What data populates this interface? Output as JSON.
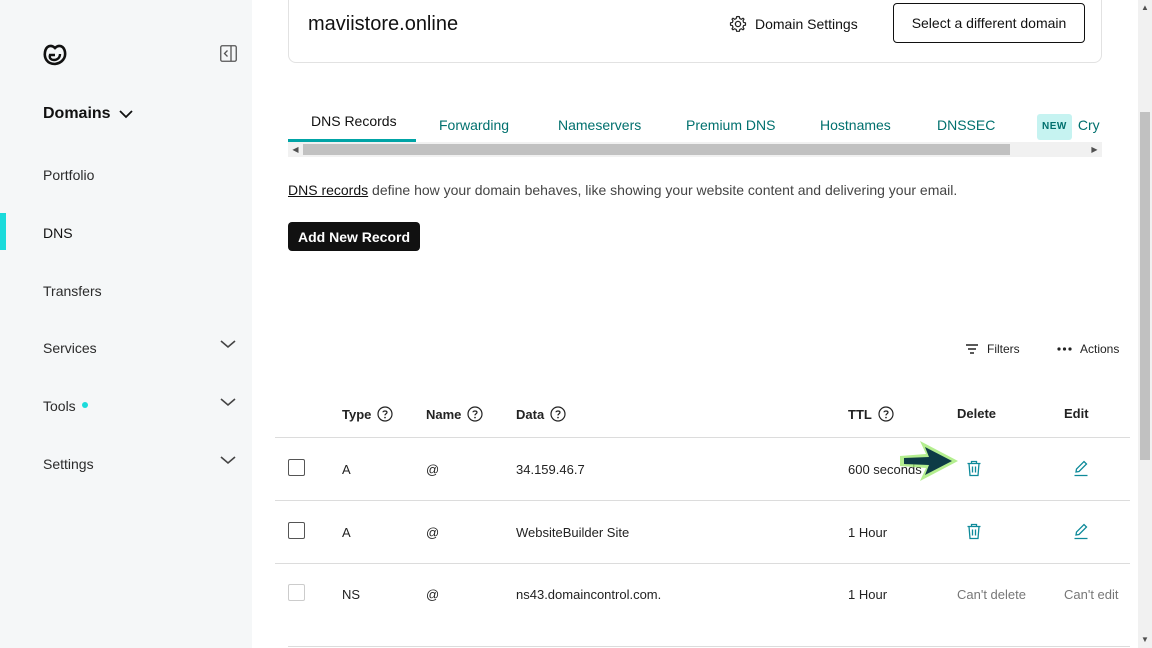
{
  "sidebar": {
    "section_title": "Domains",
    "items": [
      {
        "label": "Portfolio"
      },
      {
        "label": "DNS"
      },
      {
        "label": "Transfers"
      },
      {
        "label": "Services"
      },
      {
        "label": "Tools"
      },
      {
        "label": "Settings"
      }
    ]
  },
  "header": {
    "domain": "maviistore.online",
    "settings_label": "Domain Settings",
    "select_domain_label": "Select a different domain"
  },
  "tabs": [
    {
      "label": "DNS Records"
    },
    {
      "label": "Forwarding"
    },
    {
      "label": "Nameservers"
    },
    {
      "label": "Premium DNS"
    },
    {
      "label": "Hostnames"
    },
    {
      "label": "DNSSEC"
    },
    {
      "badge": "NEW",
      "label": "Cry"
    }
  ],
  "description": {
    "link": "DNS records",
    "text": " define how your domain behaves, like showing your website content and delivering your email."
  },
  "add_record_label": "Add New Record",
  "toolbar": {
    "filters_label": "Filters",
    "actions_label": "Actions"
  },
  "table": {
    "headers": {
      "type": "Type",
      "name": "Name",
      "data": "Data",
      "ttl": "TTL",
      "delete": "Delete",
      "edit": "Edit"
    },
    "rows": [
      {
        "type": "A",
        "name": "@",
        "data": "34.159.46.7",
        "ttl": "600 seconds"
      },
      {
        "type": "A",
        "name": "@",
        "data": "WebsiteBuilder Site",
        "ttl": "1 Hour"
      },
      {
        "type": "NS",
        "name": "@",
        "data": "ns43.domaincontrol.com.",
        "ttl": "1 Hour",
        "delete_text": "Can't delete",
        "edit_text": "Can't edit"
      }
    ]
  },
  "colors": {
    "accent": "#1bdbdb",
    "link_teal": "#00706e",
    "icon_teal": "#0e8a9a",
    "arrow_fill": "#0d3b46",
    "arrow_glow": "#9be86a"
  }
}
